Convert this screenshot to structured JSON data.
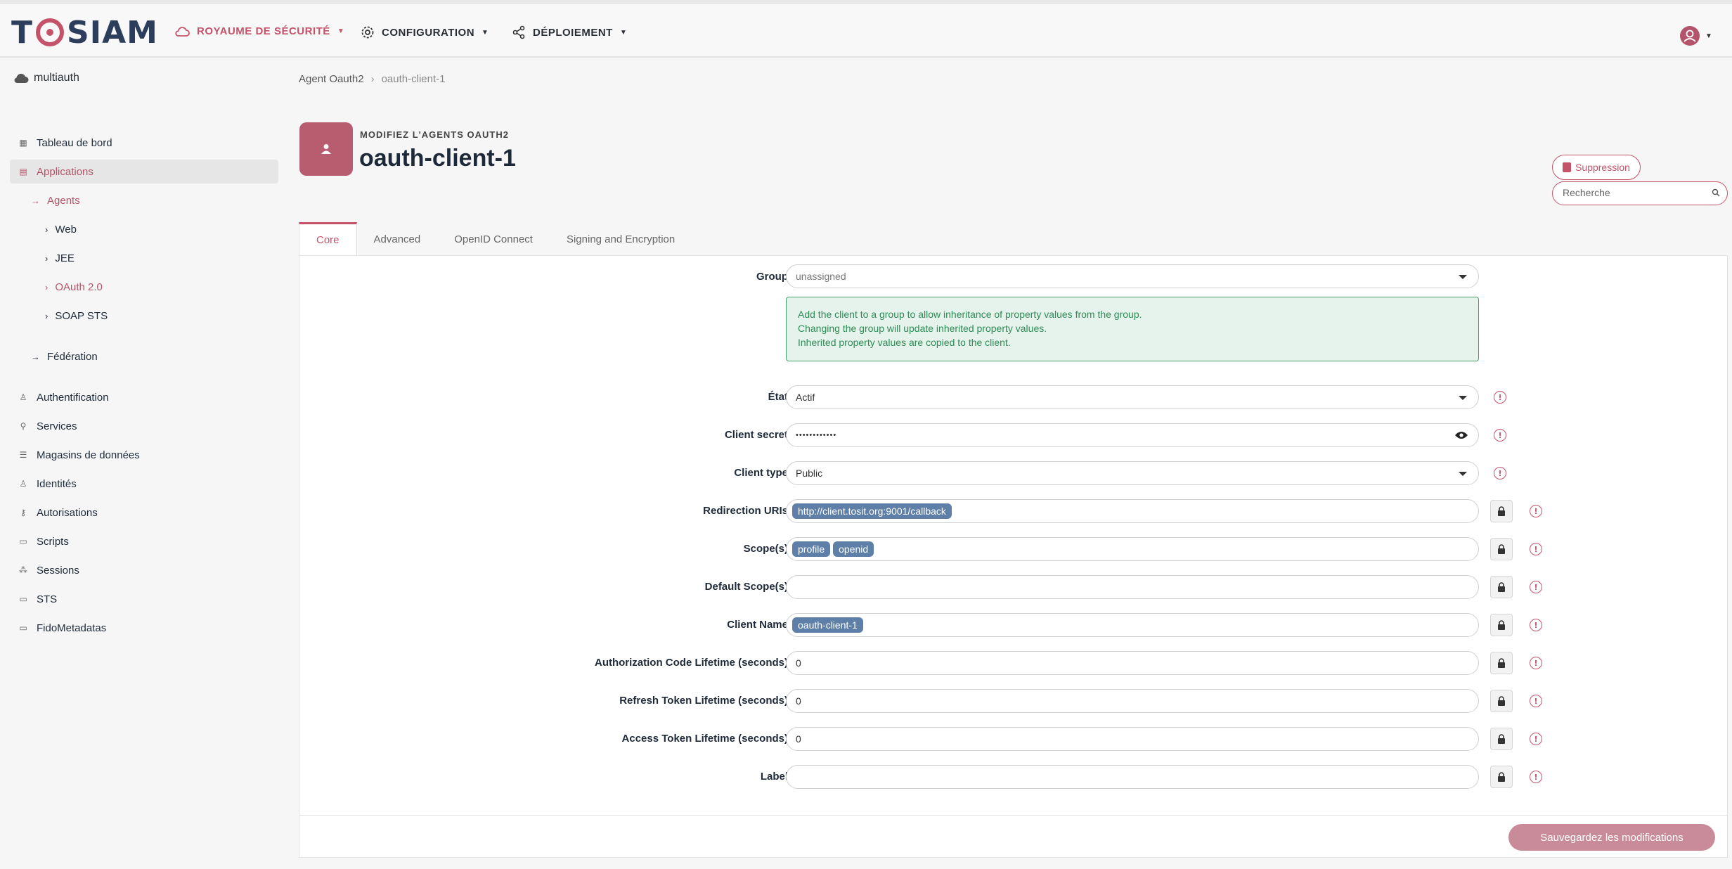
{
  "topnav": {
    "logo": {
      "left": "T",
      "right": "SIAM"
    },
    "items": [
      {
        "label": "ROYAUME DE SÉCURITÉ",
        "icon": "cloud-icon"
      },
      {
        "label": "CONFIGURATION",
        "icon": "gear-icon"
      },
      {
        "label": "DÉPLOIEMENT",
        "icon": "share-icon"
      }
    ],
    "accent": "#c4536a"
  },
  "subheader": {
    "realm": "multiauth",
    "breadcrumb": [
      "Agent Oauth2",
      "oauth-client-1"
    ]
  },
  "sidebar": {
    "items": [
      {
        "label": "Tableau de bord"
      },
      {
        "label": "Applications"
      },
      {
        "label": "Agents"
      },
      {
        "label": "Web"
      },
      {
        "label": "JEE"
      },
      {
        "label": "OAuth 2.0"
      },
      {
        "label": "SOAP STS"
      },
      {
        "label": "Fédération"
      },
      {
        "label": "Authentification"
      },
      {
        "label": "Services"
      },
      {
        "label": "Magasins de données"
      },
      {
        "label": "Identités"
      },
      {
        "label": "Autorisations"
      },
      {
        "label": "Scripts"
      },
      {
        "label": "Sessions"
      },
      {
        "label": "STS"
      },
      {
        "label": "FidoMetadatas"
      }
    ]
  },
  "header": {
    "subtitle": "MODIFIEZ L'AGENTS OAUTH2",
    "title": "oauth-client-1",
    "delete_label": "Suppression",
    "search_placeholder": "Recherche"
  },
  "tabs": [
    "Core",
    "Advanced",
    "OpenID Connect",
    "Signing and Encryption"
  ],
  "form": {
    "group": {
      "label": "Group",
      "value": "unassigned"
    },
    "alert": [
      "Add the client to a group to allow inheritance of property values from the group.",
      "Changing the group will update inherited property values.",
      "Inherited property values are copied to the client."
    ],
    "etat": {
      "label": "État",
      "value": "Actif"
    },
    "client_secret": {
      "label": "Client secret",
      "value": "••••••••••••"
    },
    "client_type": {
      "label": "Client type",
      "value": "Public"
    },
    "redirection_uris": {
      "label": "Redirection URIs",
      "chips": [
        "http://client.tosit.org:9001/callback"
      ]
    },
    "scopes": {
      "label": "Scope(s)",
      "chips": [
        "profile",
        "openid"
      ]
    },
    "default_scopes": {
      "label": "Default Scope(s)",
      "value": ""
    },
    "client_name": {
      "label": "Client Name",
      "chips": [
        "oauth-client-1"
      ]
    },
    "auth_code_lifetime": {
      "label": "Authorization Code Lifetime (seconds)",
      "value": "0"
    },
    "refresh_token_lifetime": {
      "label": "Refresh Token Lifetime (seconds)",
      "value": "0"
    },
    "access_token_lifetime": {
      "label": "Access Token Lifetime (seconds)",
      "value": "0"
    },
    "label_field": {
      "label": "Label",
      "value": ""
    }
  },
  "footer": {
    "save_label": "Sauvegardez les modifications"
  }
}
